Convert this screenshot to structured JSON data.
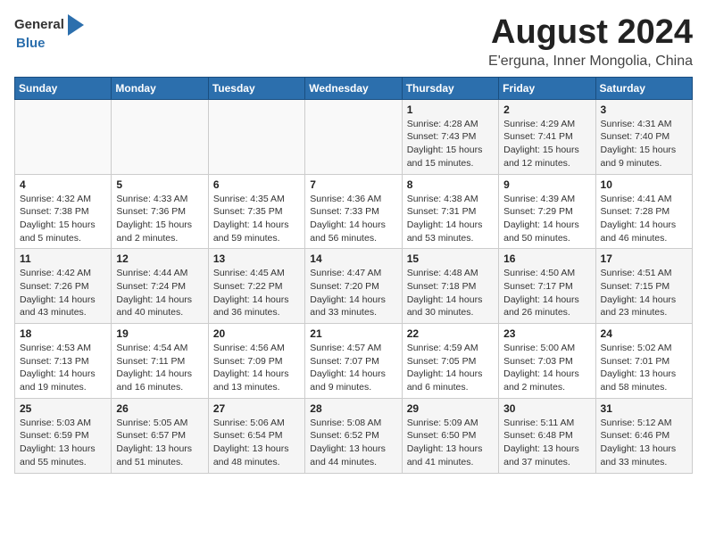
{
  "header": {
    "logo_general": "General",
    "logo_blue": "Blue",
    "title": "August 2024",
    "subtitle": "E'erguna, Inner Mongolia, China"
  },
  "calendar": {
    "days_of_week": [
      "Sunday",
      "Monday",
      "Tuesday",
      "Wednesday",
      "Thursday",
      "Friday",
      "Saturday"
    ],
    "weeks": [
      [
        {
          "day": "",
          "info": ""
        },
        {
          "day": "",
          "info": ""
        },
        {
          "day": "",
          "info": ""
        },
        {
          "day": "",
          "info": ""
        },
        {
          "day": "1",
          "sunrise": "Sunrise: 4:28 AM",
          "sunset": "Sunset: 7:43 PM",
          "daylight": "Daylight: 15 hours and 15 minutes."
        },
        {
          "day": "2",
          "sunrise": "Sunrise: 4:29 AM",
          "sunset": "Sunset: 7:41 PM",
          "daylight": "Daylight: 15 hours and 12 minutes."
        },
        {
          "day": "3",
          "sunrise": "Sunrise: 4:31 AM",
          "sunset": "Sunset: 7:40 PM",
          "daylight": "Daylight: 15 hours and 9 minutes."
        }
      ],
      [
        {
          "day": "4",
          "sunrise": "Sunrise: 4:32 AM",
          "sunset": "Sunset: 7:38 PM",
          "daylight": "Daylight: 15 hours and 5 minutes."
        },
        {
          "day": "5",
          "sunrise": "Sunrise: 4:33 AM",
          "sunset": "Sunset: 7:36 PM",
          "daylight": "Daylight: 15 hours and 2 minutes."
        },
        {
          "day": "6",
          "sunrise": "Sunrise: 4:35 AM",
          "sunset": "Sunset: 7:35 PM",
          "daylight": "Daylight: 14 hours and 59 minutes."
        },
        {
          "day": "7",
          "sunrise": "Sunrise: 4:36 AM",
          "sunset": "Sunset: 7:33 PM",
          "daylight": "Daylight: 14 hours and 56 minutes."
        },
        {
          "day": "8",
          "sunrise": "Sunrise: 4:38 AM",
          "sunset": "Sunset: 7:31 PM",
          "daylight": "Daylight: 14 hours and 53 minutes."
        },
        {
          "day": "9",
          "sunrise": "Sunrise: 4:39 AM",
          "sunset": "Sunset: 7:29 PM",
          "daylight": "Daylight: 14 hours and 50 minutes."
        },
        {
          "day": "10",
          "sunrise": "Sunrise: 4:41 AM",
          "sunset": "Sunset: 7:28 PM",
          "daylight": "Daylight: 14 hours and 46 minutes."
        }
      ],
      [
        {
          "day": "11",
          "sunrise": "Sunrise: 4:42 AM",
          "sunset": "Sunset: 7:26 PM",
          "daylight": "Daylight: 14 hours and 43 minutes."
        },
        {
          "day": "12",
          "sunrise": "Sunrise: 4:44 AM",
          "sunset": "Sunset: 7:24 PM",
          "daylight": "Daylight: 14 hours and 40 minutes."
        },
        {
          "day": "13",
          "sunrise": "Sunrise: 4:45 AM",
          "sunset": "Sunset: 7:22 PM",
          "daylight": "Daylight: 14 hours and 36 minutes."
        },
        {
          "day": "14",
          "sunrise": "Sunrise: 4:47 AM",
          "sunset": "Sunset: 7:20 PM",
          "daylight": "Daylight: 14 hours and 33 minutes."
        },
        {
          "day": "15",
          "sunrise": "Sunrise: 4:48 AM",
          "sunset": "Sunset: 7:18 PM",
          "daylight": "Daylight: 14 hours and 30 minutes."
        },
        {
          "day": "16",
          "sunrise": "Sunrise: 4:50 AM",
          "sunset": "Sunset: 7:17 PM",
          "daylight": "Daylight: 14 hours and 26 minutes."
        },
        {
          "day": "17",
          "sunrise": "Sunrise: 4:51 AM",
          "sunset": "Sunset: 7:15 PM",
          "daylight": "Daylight: 14 hours and 23 minutes."
        }
      ],
      [
        {
          "day": "18",
          "sunrise": "Sunrise: 4:53 AM",
          "sunset": "Sunset: 7:13 PM",
          "daylight": "Daylight: 14 hours and 19 minutes."
        },
        {
          "day": "19",
          "sunrise": "Sunrise: 4:54 AM",
          "sunset": "Sunset: 7:11 PM",
          "daylight": "Daylight: 14 hours and 16 minutes."
        },
        {
          "day": "20",
          "sunrise": "Sunrise: 4:56 AM",
          "sunset": "Sunset: 7:09 PM",
          "daylight": "Daylight: 14 hours and 13 minutes."
        },
        {
          "day": "21",
          "sunrise": "Sunrise: 4:57 AM",
          "sunset": "Sunset: 7:07 PM",
          "daylight": "Daylight: 14 hours and 9 minutes."
        },
        {
          "day": "22",
          "sunrise": "Sunrise: 4:59 AM",
          "sunset": "Sunset: 7:05 PM",
          "daylight": "Daylight: 14 hours and 6 minutes."
        },
        {
          "day": "23",
          "sunrise": "Sunrise: 5:00 AM",
          "sunset": "Sunset: 7:03 PM",
          "daylight": "Daylight: 14 hours and 2 minutes."
        },
        {
          "day": "24",
          "sunrise": "Sunrise: 5:02 AM",
          "sunset": "Sunset: 7:01 PM",
          "daylight": "Daylight: 13 hours and 58 minutes."
        }
      ],
      [
        {
          "day": "25",
          "sunrise": "Sunrise: 5:03 AM",
          "sunset": "Sunset: 6:59 PM",
          "daylight": "Daylight: 13 hours and 55 minutes."
        },
        {
          "day": "26",
          "sunrise": "Sunrise: 5:05 AM",
          "sunset": "Sunset: 6:57 PM",
          "daylight": "Daylight: 13 hours and 51 minutes."
        },
        {
          "day": "27",
          "sunrise": "Sunrise: 5:06 AM",
          "sunset": "Sunset: 6:54 PM",
          "daylight": "Daylight: 13 hours and 48 minutes."
        },
        {
          "day": "28",
          "sunrise": "Sunrise: 5:08 AM",
          "sunset": "Sunset: 6:52 PM",
          "daylight": "Daylight: 13 hours and 44 minutes."
        },
        {
          "day": "29",
          "sunrise": "Sunrise: 5:09 AM",
          "sunset": "Sunset: 6:50 PM",
          "daylight": "Daylight: 13 hours and 41 minutes."
        },
        {
          "day": "30",
          "sunrise": "Sunrise: 5:11 AM",
          "sunset": "Sunset: 6:48 PM",
          "daylight": "Daylight: 13 hours and 37 minutes."
        },
        {
          "day": "31",
          "sunrise": "Sunrise: 5:12 AM",
          "sunset": "Sunset: 6:46 PM",
          "daylight": "Daylight: 13 hours and 33 minutes."
        }
      ]
    ]
  }
}
